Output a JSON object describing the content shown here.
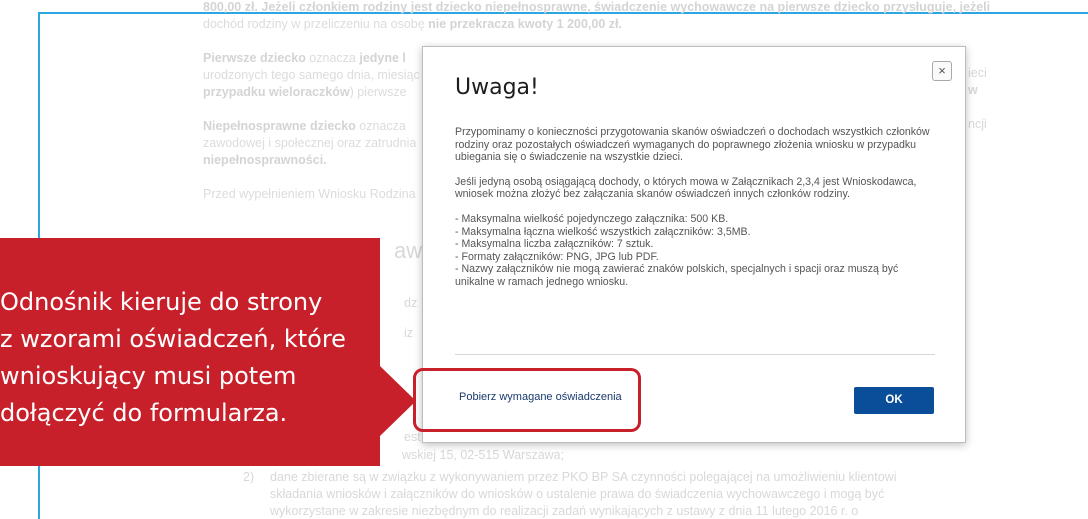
{
  "background": {
    "line1": "800,00 zł. Jeżeli członkiem rodziny jest dziecko niepełnosprawne, świadczenie wychowawcze na pierwsze dziecko przysługuje, jeżeli",
    "line2_pre": "dochód rodziny w przeliczeniu na osobę ",
    "line2_bold": "nie przekracza kwoty 1 200,00 zł.",
    "p2_bold": "Pierwsze dziecko",
    "p2_a": " oznacza ",
    "p2_bold2": "jedyne l",
    "p2_line2": "urodzonych tego samego dnia, miesiąc",
    "p2_line3_bold": "przypadku wieloraczków",
    "p2_line3_rest": ") pierwsze",
    "p2_right": "ieci",
    "p2_right2": "w",
    "p3_bold": "Niepełnosprawne dziecko",
    "p3_a": " oznacza",
    "p3_line2": "zawodowej i społecznej oraz zatrudnia",
    "p3_line3_bold": "niepełnosprawności.",
    "p3_right": "ncji",
    "p4": "Przed wypełnieniem Wniosku Rodzina",
    "frag_heading": "aw",
    "frag_dz": "dz",
    "frag_iz": "iz",
    "frag_est": "est",
    "addr": "wskiej 15, 02-515 Warszawa;",
    "item2_num": "2)",
    "item2_line1": "dane zbierane są w związku z wykonywaniem przez PKO BP SA czynności polegającej na umożliwieniu klientowi",
    "item2_line2": "składania wniosków i załączników do wniosków o ustalenie prawa do świadczenia wychowawczego i mogą być",
    "item2_line3": "wykorzystane w zakresie niezbędnym do realizacji zadań wynikających z ustawy z dnia 11 lutego 2016 r. o"
  },
  "modal": {
    "title": "Uwaga!",
    "close_symbol": "×",
    "para1": "Przypominamy o konieczności przygotowania skanów oświadczeń o dochodach wszystkich członków rodziny oraz pozostałych oświadczeń wymaganych do poprawnego złożenia wniosku w przypadku ubiegania się o świadczenie na wszystkie dzieci.",
    "para2": "Jeśli jedyną osobą osiągającą dochody, o których mowa w Załącznikach 2,3,4 jest Wnioskodawca, wniosek można złożyć bez załączania skanów oświadczeń innych członków rodziny.",
    "rules": [
      "- Maksymalna wielkość pojedynczego załącznika: 500 KB.",
      "- Maksymalna łączna wielkość wszystkich załączników: 3,5MB.",
      "- Maksymalna liczba załączników: 7 sztuk.",
      "- Formaty załączników: PNG, JPG lub PDF.",
      "- Nazwy załączników nie mogą zawierać znaków polskich, specjalnych i spacji oraz muszą być unikalne w ramach jednego wniosku."
    ],
    "download_link": "Pobierz wymagane oświadczenia",
    "ok_button": "OK"
  },
  "callout": {
    "line1": "Odnośnik kieruje do strony",
    "line2": "z wzorami oświadczeń, które",
    "line3": "wnioskujący musi potem",
    "line4": "dołączyć do formularza."
  },
  "colors": {
    "accent_blue": "#2aa6e0",
    "callout_red": "#c8202b",
    "ok_button": "#0a4e9a"
  }
}
